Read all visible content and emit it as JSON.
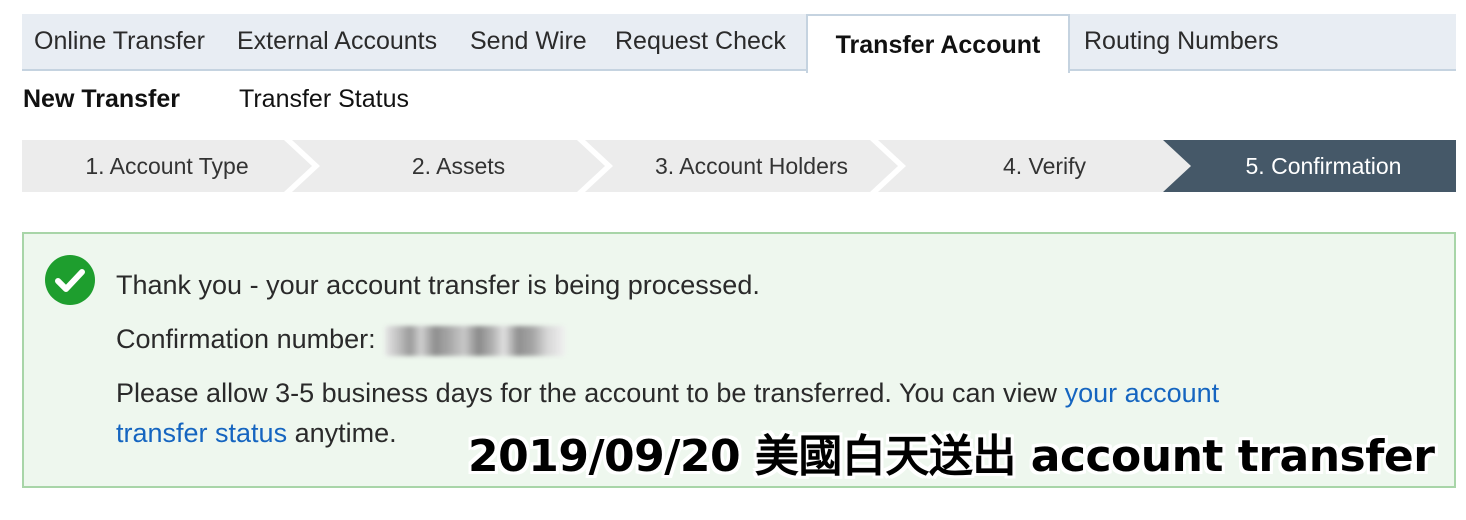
{
  "tabs": [
    {
      "label": "Online Transfer",
      "active": false
    },
    {
      "label": "External Accounts",
      "active": false
    },
    {
      "label": "Send Wire",
      "active": false
    },
    {
      "label": "Request Check",
      "active": false
    },
    {
      "label": "Transfer Account",
      "active": true
    },
    {
      "label": "Routing Numbers",
      "active": false
    }
  ],
  "subnav": [
    {
      "label": "New Transfer",
      "active": true
    },
    {
      "label": "Transfer Status",
      "active": false
    }
  ],
  "steps": [
    {
      "label": "1. Account Type"
    },
    {
      "label": "2. Assets"
    },
    {
      "label": "3. Account Holders"
    },
    {
      "label": "4. Verify"
    },
    {
      "label": "5. Confirmation",
      "current": true
    }
  ],
  "confirmation": {
    "icon": "check-circle-icon",
    "thank_you": "Thank you - your account transfer is being processed.",
    "number_label": "Confirmation number:",
    "allow_text": "Please allow 3-5 business days for the account to be transferred. You can view",
    "link_text_1": "your account",
    "link_text_2": "transfer status",
    "after_link": "anytime."
  },
  "caption": "2019/09/20 美國白天送出 account transfer",
  "colors": {
    "tab_bar_bg": "#e8edf3",
    "step_bg": "#ececec",
    "step_current_bg": "#455868",
    "panel_bg": "#eef7ee",
    "panel_border": "#a8d5a8",
    "check_green": "#1e9e2e",
    "link": "#1565c0"
  }
}
